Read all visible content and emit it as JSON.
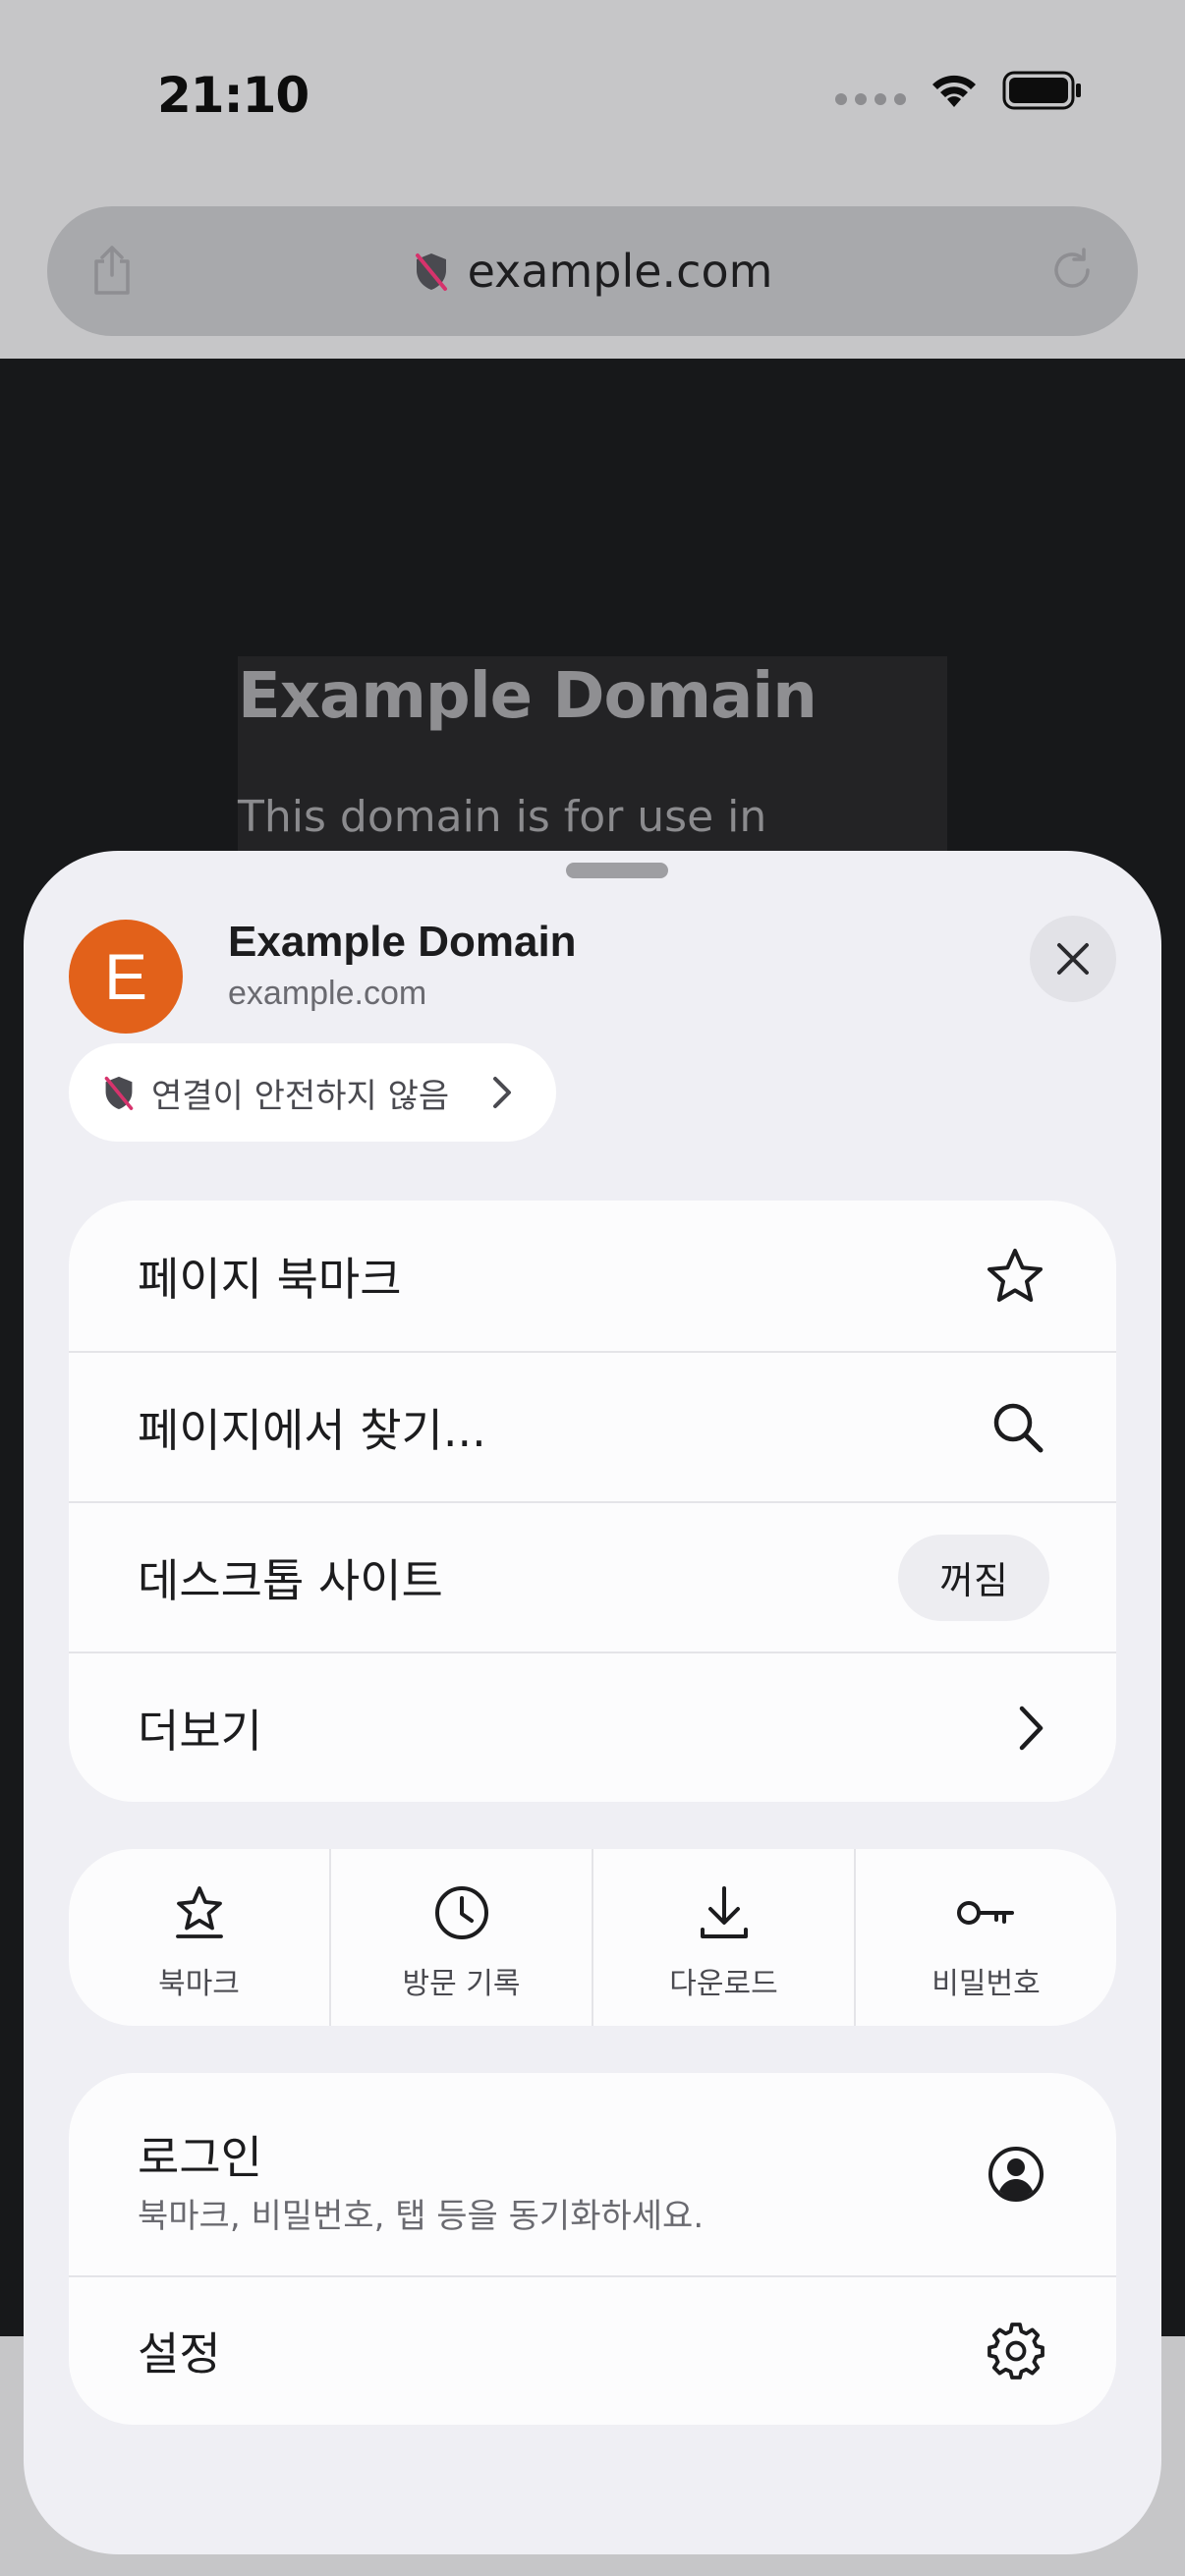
{
  "status_bar": {
    "time": "21:10"
  },
  "address_bar": {
    "url": "example.com"
  },
  "page": {
    "title": "Example Domain",
    "text": "This domain is for use in"
  },
  "sheet": {
    "avatar_letter": "E",
    "site_title": "Example Domain",
    "site_url": "example.com",
    "security_label": "연결이 안전하지 않음",
    "menu": {
      "bookmark_page": "페이지 북마크",
      "find_in_page": "페이지에서 찾기...",
      "desktop_site": "데스크톱 사이트",
      "desktop_site_state": "꺼짐",
      "more": "더보기"
    },
    "quick_actions": {
      "bookmarks": "북마크",
      "history": "방문 기록",
      "downloads": "다운로드",
      "passwords": "비밀번호"
    },
    "account": {
      "login_title": "로그인",
      "login_subtitle": "북마크, 비밀번호, 탭 등을 동기화하세요.",
      "settings": "설정"
    }
  },
  "colors": {
    "avatar": "#e2611a",
    "insecure_slash": "#d6336c",
    "sheet_background": "#efeff4"
  }
}
